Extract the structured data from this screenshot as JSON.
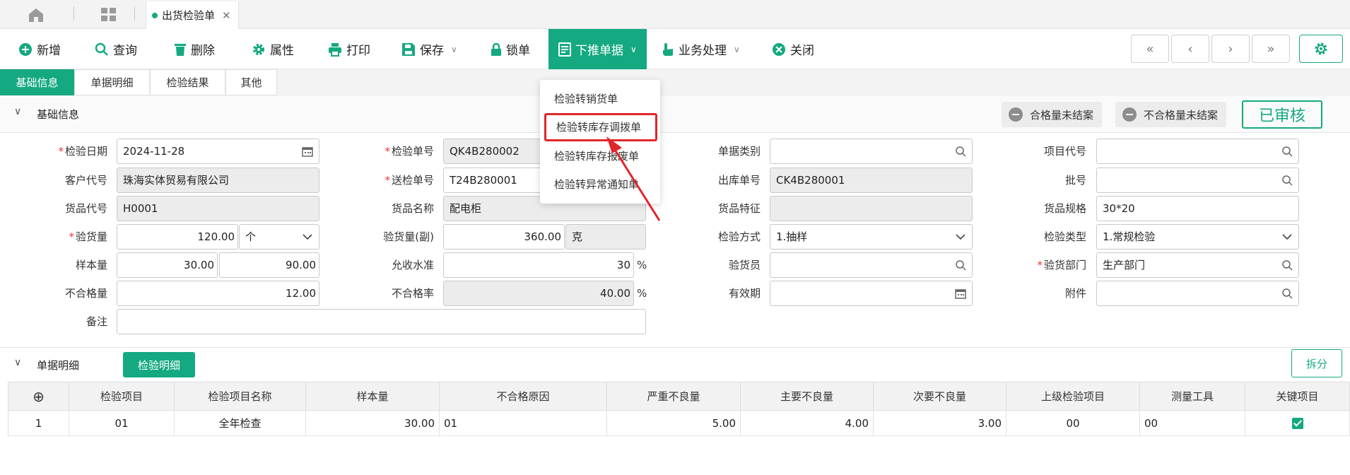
{
  "tabbar": {
    "document_tab": "出货检验单"
  },
  "toolbar": {
    "new": "新增",
    "query": "查询",
    "delete": "删除",
    "properties": "属性",
    "print": "打印",
    "save": "保存",
    "lock": "锁单",
    "push_down": "下推单据",
    "business": "业务处理",
    "close": "关闭",
    "first": "«",
    "prev": "‹",
    "next": "›",
    "last": "»"
  },
  "subtabs": [
    "基础信息",
    "单据明细",
    "检验结果",
    "其他"
  ],
  "section_basic": {
    "title": "基础信息",
    "pill_qualified": "合格量未结案",
    "pill_unqualified": "不合格量未结案",
    "stamp": "已审核"
  },
  "form": {
    "inspect_date": {
      "label": "检验日期",
      "value": "2024-11-28"
    },
    "inspect_no": {
      "label": "检验单号",
      "value": "QK4B280002"
    },
    "doc_category": {
      "label": "单据类别",
      "value": ""
    },
    "project_code": {
      "label": "项目代号",
      "value": ""
    },
    "customer_code": {
      "label": "客户代号",
      "value": "珠海实体贸易有限公司"
    },
    "send_no": {
      "label": "送检单号",
      "value": "T24B280001"
    },
    "outbound_no": {
      "label": "出库单号",
      "value": "CK4B280001"
    },
    "batch_no": {
      "label": "批号",
      "value": ""
    },
    "goods_code": {
      "label": "货品代号",
      "value": "H0001"
    },
    "goods_name": {
      "label": "货品名称",
      "value": "配电柜"
    },
    "goods_feature": {
      "label": "货品特征",
      "value": ""
    },
    "goods_spec": {
      "label": "货品规格",
      "value": "30*20"
    },
    "inspect_qty": {
      "label": "验货量",
      "value": "120.00",
      "unit": "个"
    },
    "inspect_qty2": {
      "label": "验货量(副)",
      "value": "360.00",
      "unit": "克"
    },
    "inspect_method": {
      "label": "检验方式",
      "value": "1.抽样"
    },
    "inspect_type": {
      "label": "检验类型",
      "value": "1.常规检验"
    },
    "sample_qty": {
      "label": "样本量",
      "value1": "30.00",
      "value2": "90.00"
    },
    "accept_level": {
      "label": "允收水准",
      "value": "30",
      "suffix": "%"
    },
    "inspector": {
      "label": "验货员",
      "value": ""
    },
    "inspect_dept": {
      "label": "验货部门",
      "value": "生产部门"
    },
    "unqualified_qty": {
      "label": "不合格量",
      "value": "12.00"
    },
    "unqualified_rate": {
      "label": "不合格率",
      "value": "40.00",
      "suffix": "%"
    },
    "valid_period": {
      "label": "有效期",
      "value": ""
    },
    "attachment": {
      "label": "附件",
      "value": ""
    },
    "remark": {
      "label": "备注",
      "value": ""
    }
  },
  "section_detail": {
    "title": "单据明细",
    "tab": "检验明细",
    "split": "拆分"
  },
  "grid": {
    "columns": [
      "⊕",
      "检验项目",
      "检验项目名称",
      "样本量",
      "不合格原因",
      "严重不良量",
      "主要不良量",
      "次要不良量",
      "上级检验项目",
      "测量工具",
      "关键项目"
    ],
    "rows": [
      {
        "idx": "1",
        "item": "01",
        "name": "全年检查",
        "sample": "30.00",
        "reason": "01",
        "critical": "5.00",
        "major": "4.00",
        "minor": "3.00",
        "parent": "00",
        "tool": "00",
        "key": true
      }
    ]
  },
  "menu": {
    "items": [
      "检验转销货单",
      "检验转库存调拨单",
      "检验转库存报废单",
      "检验转异常通知单"
    ],
    "highlighted_index": 1
  },
  "colors": {
    "accent": "#15a981",
    "highlight": "#e0262b"
  }
}
